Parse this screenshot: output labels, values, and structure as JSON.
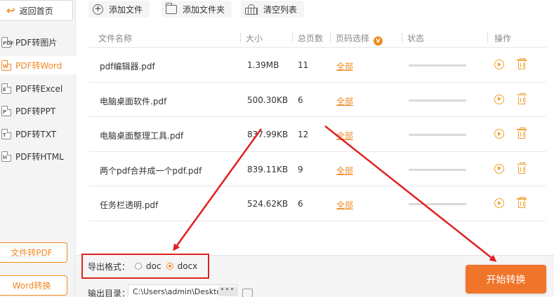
{
  "sidebar": {
    "back_label": "返回首页",
    "items": [
      {
        "label": "PDF转图片",
        "tag": "PDF",
        "active": false
      },
      {
        "label": "PDF转Word",
        "tag": "W",
        "active": true
      },
      {
        "label": "PDF转Excel",
        "tag": "E",
        "active": false
      },
      {
        "label": "PDF转PPT",
        "tag": "P",
        "active": false
      },
      {
        "label": "PDF转TXT",
        "tag": "T",
        "active": false
      },
      {
        "label": "PDF转HTML",
        "tag": "H",
        "active": false
      }
    ],
    "buttons": [
      "文件转PDF",
      "Word转换"
    ]
  },
  "toolbar": {
    "add_file": "添加文件",
    "add_folder": "添加文件夹",
    "clear_list": "清空列表"
  },
  "table": {
    "headers": {
      "name": "文件名称",
      "size": "大小",
      "pages": "总页数",
      "page_select": "页码选择",
      "status": "状态",
      "ops": "操作"
    },
    "badge": "V",
    "rows": [
      {
        "name": "pdf编辑器.pdf",
        "size": "1.39MB",
        "pages": "11",
        "page_select": "全部",
        "progress": 0
      },
      {
        "name": "电脑桌面软件.pdf",
        "size": "500.30KB",
        "pages": "6",
        "page_select": "全部",
        "progress": 0
      },
      {
        "name": "电脑桌面整理工具.pdf",
        "size": "837.99KB",
        "pages": "12",
        "page_select": "全部",
        "progress": 0
      },
      {
        "name": "两个pdf合并成一个pdf.pdf",
        "size": "839.11KB",
        "pages": "9",
        "page_select": "全部",
        "progress": 0
      },
      {
        "name": "任务栏透明.pdf",
        "size": "524.62KB",
        "pages": "6",
        "page_select": "全部",
        "progress": 0
      }
    ]
  },
  "export": {
    "label": "导出格式：",
    "options": [
      "doc",
      "docx"
    ],
    "selected": "docx"
  },
  "output": {
    "label": "输出目录：",
    "path": "C:\\Users\\admin\\Desktop\\",
    "dots": "•••"
  },
  "start_button": "开始转换",
  "colors": {
    "accent": "#f08a24",
    "start_button": "#f0742a",
    "annotation_red": "#e02020"
  }
}
